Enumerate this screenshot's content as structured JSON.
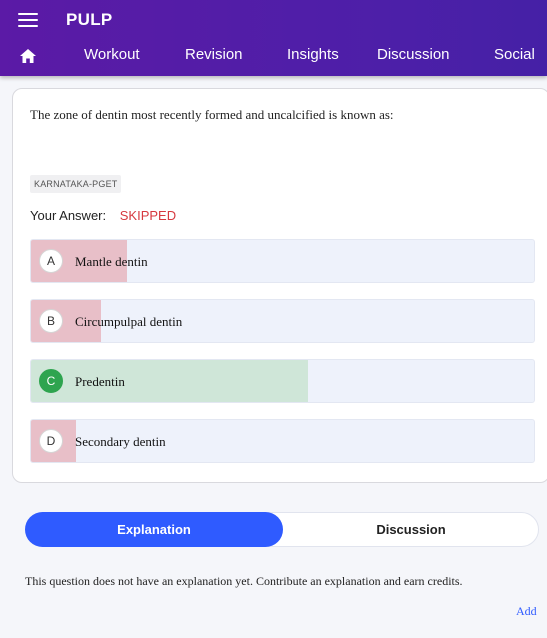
{
  "app": {
    "title": "PULP"
  },
  "nav": {
    "tabs": [
      "Workout",
      "Revision",
      "Insights",
      "Discussion",
      "Social"
    ]
  },
  "question": {
    "text": "The zone of dentin most recently formed and uncalcified is known as:",
    "tag": "KARNATAKA-PGET",
    "your_answer_label": "Your Answer:",
    "your_answer_value": "SKIPPED"
  },
  "options": [
    {
      "letter": "A",
      "text": "Mantle dentin",
      "share": 0.19,
      "correct": false
    },
    {
      "letter": "B",
      "text": "Circumpulpal dentin",
      "share": 0.14,
      "correct": false
    },
    {
      "letter": "C",
      "text": "Predentin",
      "share": 0.55,
      "correct": true
    },
    {
      "letter": "D",
      "text": "Secondary dentin",
      "share": 0.09,
      "correct": false
    }
  ],
  "colors": {
    "correct_fill": "#cfe6d8",
    "wrong_fill": "#e8bfc8",
    "accent": "#2f5bff",
    "appbar": "#5b1aa6"
  },
  "explanation": {
    "tabs": [
      "Explanation",
      "Discussion"
    ],
    "active_tab": "Explanation",
    "message": "This question does not have an explanation yet. Contribute an explanation and earn credits.",
    "add_label": "Add"
  }
}
